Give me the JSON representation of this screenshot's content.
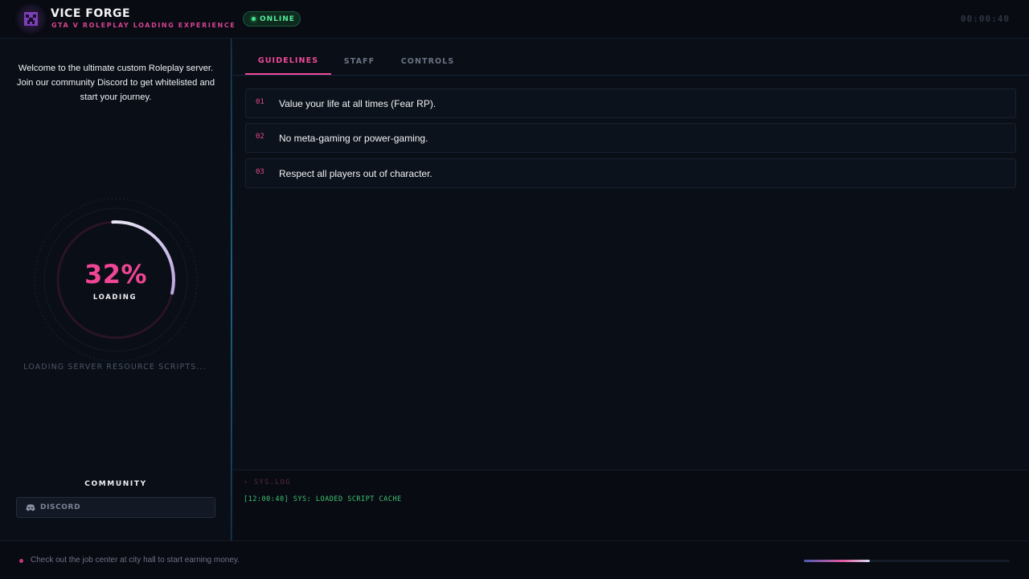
{
  "header": {
    "title": "VICE FORGE",
    "subtitle": "GTA V ROLEPLAY LOADING EXPERIENCE",
    "status_badge": "ONLINE",
    "clock": "00:00:40",
    "logo_icon": "creeper-face-icon"
  },
  "sidebar": {
    "welcome": "Welcome to the ultimate custom Roleplay server. Join our community Discord to get whitelisted and start your journey.",
    "progress": {
      "percent_label": "32%",
      "value": 0.32,
      "caption": "LOADING"
    },
    "status": "LOADING SERVER RESOURCE SCRIPTS...",
    "community_title": "COMMUNITY",
    "discord_label": "DISCORD"
  },
  "tabs": [
    {
      "label": "GUIDELINES",
      "active": true
    },
    {
      "label": "STAFF",
      "active": false
    },
    {
      "label": "CONTROLS",
      "active": false
    }
  ],
  "guidelines": [
    {
      "num": "01",
      "text": "Value your life at all times (Fear RP)."
    },
    {
      "num": "02",
      "text": "No meta-gaming or power-gaming."
    },
    {
      "num": "03",
      "text": "Respect all players out of character."
    }
  ],
  "log": {
    "title": "› SYS.LOG",
    "lines": [
      "[12:00:40] SYS: LOADED SCRIPT CACHE"
    ]
  },
  "footer": {
    "tip": "Check out the job center at city hall to start earning money.",
    "progress": 0.32
  },
  "colors": {
    "accent": "#ef4a98",
    "online": "#3ee38a",
    "log_text": "#3fc474",
    "background": "#0a0e16"
  }
}
